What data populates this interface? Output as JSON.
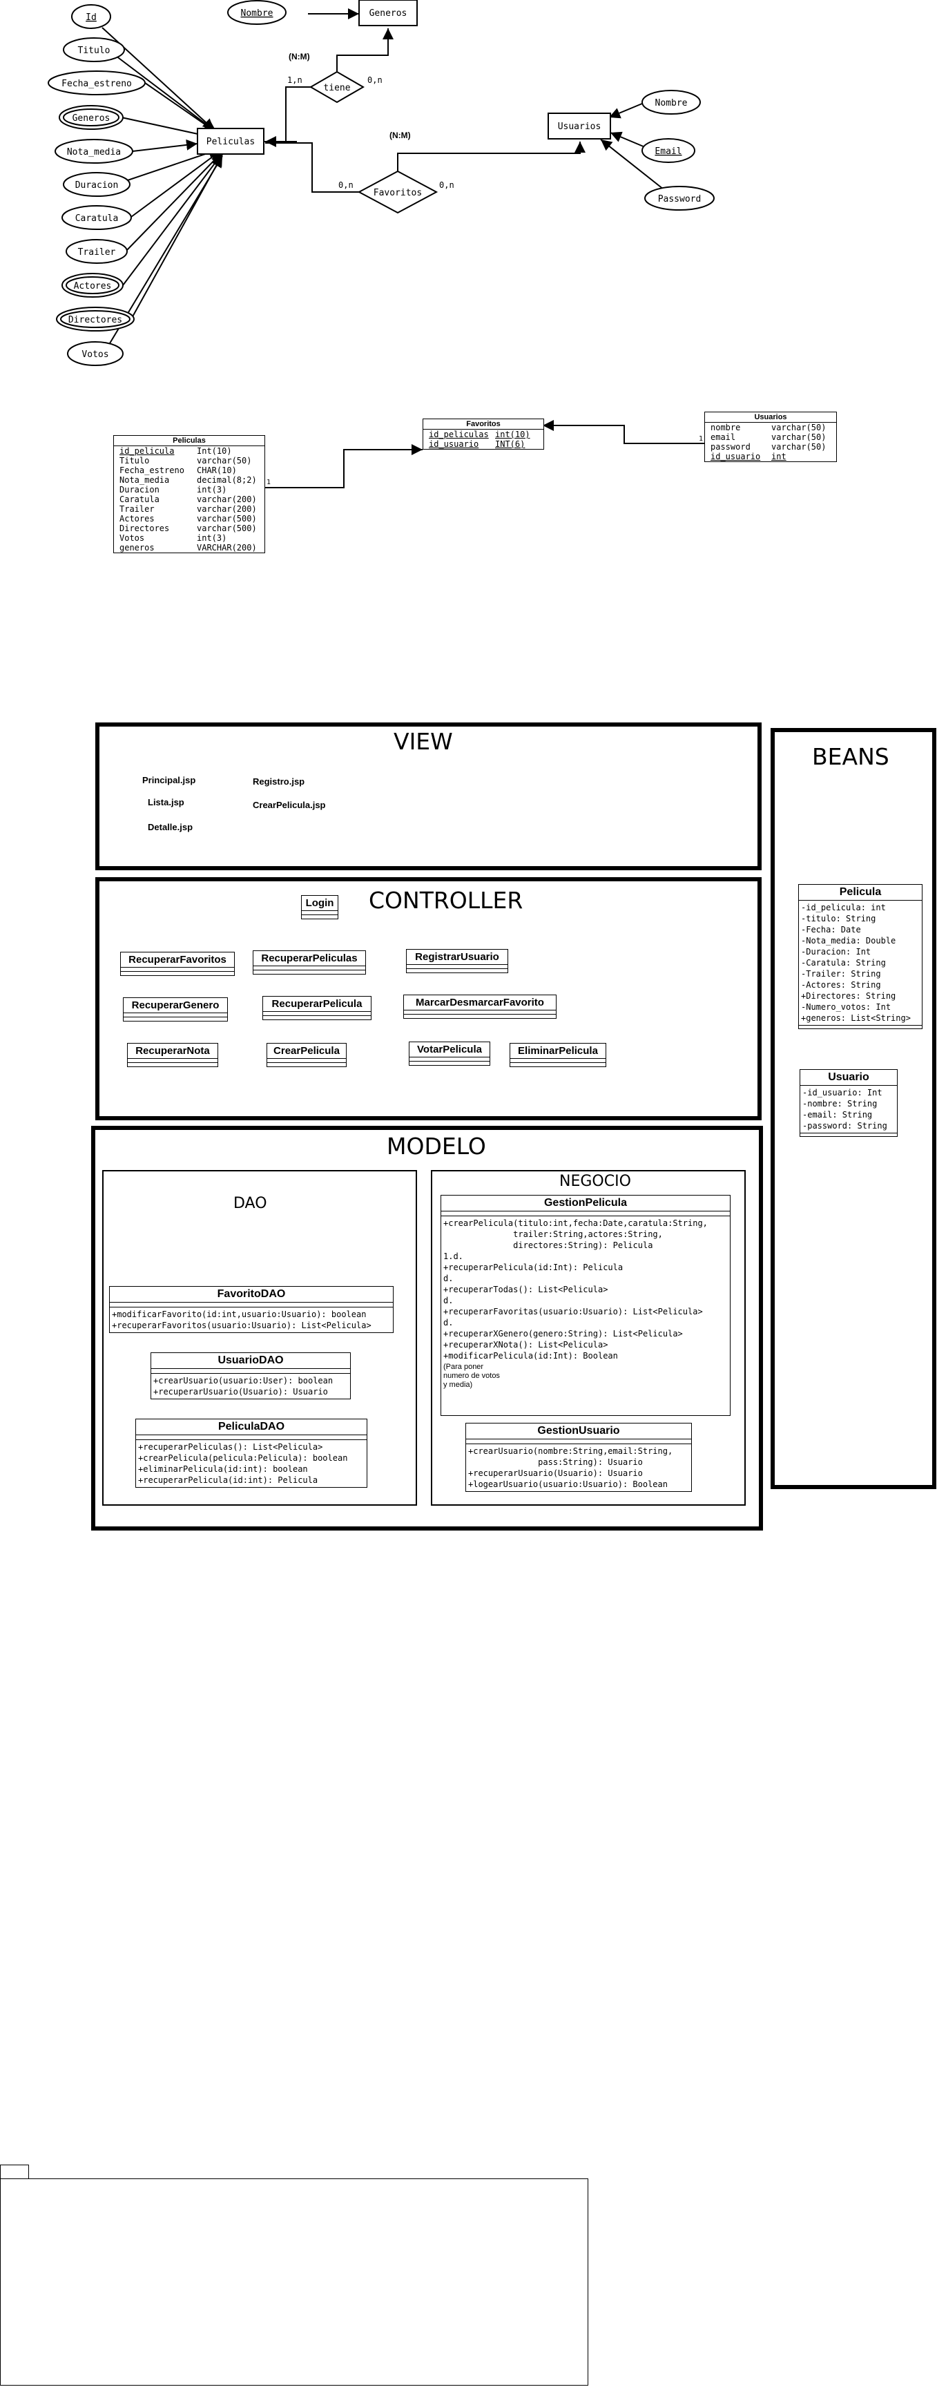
{
  "er": {
    "entities": {
      "peliculas": "Peliculas",
      "generos": "Generos",
      "usuarios": "Usuarios"
    },
    "attributes": {
      "id": "Id",
      "titulo": "Titulo",
      "fecha_estreno": "Fecha_estreno",
      "generos": "Generos",
      "nota_media": "Nota_media",
      "duracion": "Duracion",
      "caratula": "Caratula",
      "trailer": "Trailer",
      "actores": "Actores",
      "directores": "Directores",
      "votos": "Votos",
      "genero_nombre": "Nombre",
      "usuario_nombre": "Nombre",
      "email": "Email",
      "password": "Password"
    },
    "relations": {
      "tiene": "tiene",
      "favoritos": "Favoritos"
    },
    "cardinality": {
      "tiene_type": "(N:M)",
      "favoritos_type": "(N:M)",
      "tiene_left": "1,n",
      "tiene_right": "0,n",
      "fav_left": "0,n",
      "fav_right": "0,n"
    }
  },
  "tables": {
    "peliculas": {
      "name": "Peliculas",
      "rows": [
        {
          "field": "id_pelicula",
          "type": "Int(10)"
        },
        {
          "field": "Titulo",
          "type": "varchar(50)"
        },
        {
          "field": "Fecha_estreno",
          "type": "CHAR(10)"
        },
        {
          "field": "Nota_media",
          "type": "decimal(8;2)"
        },
        {
          "field": "Duracion",
          "type": "int(3)"
        },
        {
          "field": "Caratula",
          "type": "varchar(200)"
        },
        {
          "field": "Trailer",
          "type": "varchar(200)"
        },
        {
          "field": "Actores",
          "type": "varchar(500)"
        },
        {
          "field": "Directores",
          "type": "varchar(500)"
        },
        {
          "field": "Votos",
          "type": "int(3)"
        },
        {
          "field": "generos",
          "type": "VARCHAR(200)"
        }
      ]
    },
    "favoritos": {
      "name": "Favoritos",
      "rows": [
        {
          "field": "id_peliculas",
          "type": "int(10)"
        },
        {
          "field": "id_usuario",
          "type": "INT(6)"
        }
      ]
    },
    "usuarios": {
      "name": "Usuarios",
      "rows": [
        {
          "field": "nombre",
          "type": "varchar(50)"
        },
        {
          "field": "email",
          "type": "varchar(50)"
        },
        {
          "field": "password",
          "type": "varchar(50)"
        },
        {
          "field": "id_usuario",
          "type": "int"
        }
      ]
    },
    "marks": {
      "one_left": "1",
      "one_right": "1"
    }
  },
  "view": {
    "title": "VIEW",
    "pages": [
      "Principal.jsp",
      "Lista.jsp",
      "Detalle.jsp",
      "Registro.jsp",
      "CrearPelicula.jsp"
    ]
  },
  "beans": {
    "title": "BEANS",
    "pelicula": {
      "name": "Pelicula",
      "fields": "-id_pelicula: int\n-titulo: String\n-Fecha: Date\n-Nota_media: Double\n-Duracion: Int\n-Caratula: String\n-Trailer: String\n-Actores: String\n+Directores: String\n-Numero_votos: Int\n+generos: List<String>"
    },
    "usuario": {
      "name": "Usuario",
      "fields": "-id_usuario: Int\n-nombre: String\n-email: String\n-password: String"
    }
  },
  "controller": {
    "title": "CONTROLLER",
    "classes": [
      "Login",
      "RecuperarFavoritos",
      "RecuperarPeliculas",
      "RegistrarUsuario",
      "RecuperarGenero",
      "RecuperarPelicula",
      "MarcarDesmarcarFavorito",
      "RecuperarNota",
      "CrearPelicula",
      "VotarPelicula",
      "EliminarPelicula"
    ]
  },
  "modelo": {
    "title": "MODELO",
    "dao": {
      "title": "DAO",
      "favorito": {
        "name": "FavoritoDAO",
        "methods": "+modificarFavorito(id:int,usuario:Usuario): boolean\n+recuperarFavoritos(usuario:Usuario): List<Pelicula>"
      },
      "usuario": {
        "name": "UsuarioDAO",
        "methods": "+crearUsuario(usuario:User): boolean\n+recuperarUsuario(Usuario): Usuario"
      },
      "pelicula": {
        "name": "PeliculaDAO",
        "methods": "+recuperarPeliculas(): List<Pelicula>\n+crearPelicula(pelicula:Pelicula): boolean\n+eliminarPelicula(id:int): boolean\n+recuperarPelicula(id:int): Pelicula"
      }
    },
    "negocio": {
      "title": "NEGOCIO",
      "gestion_pelicula": {
        "name": "GestionPelicula",
        "methods": "+crearPelicula(titulo:int,fecha:Date,caratula:String,\n              trailer:String,actores:String,\n              directores:String): Pelicula\n1.d.\n+recuperarPelicula(id:Int): Pelicula\nd.\n+recuperarTodas(): List<Pelicula>\nd.\n+recuperarFavoritas(usuario:Usuario): List<Pelicula>\nd.\n+recuperarXGenero(genero:String): List<Pelicula>\n+recuperarXNota(): List<Pelicula>\n+modificarPelicula(id:Int): Boolean",
        "note": "(Para poner\nnumero de votos\ny media)"
      },
      "gestion_usuario": {
        "name": "GestionUsuario",
        "methods": "+crearUsuario(nombre:String,email:String,\n              pass:String): Usuario\n+recuperarUsuario(Usuario): Usuario\n+logearUsuario(usuario:Usuario): Boolean"
      }
    }
  }
}
